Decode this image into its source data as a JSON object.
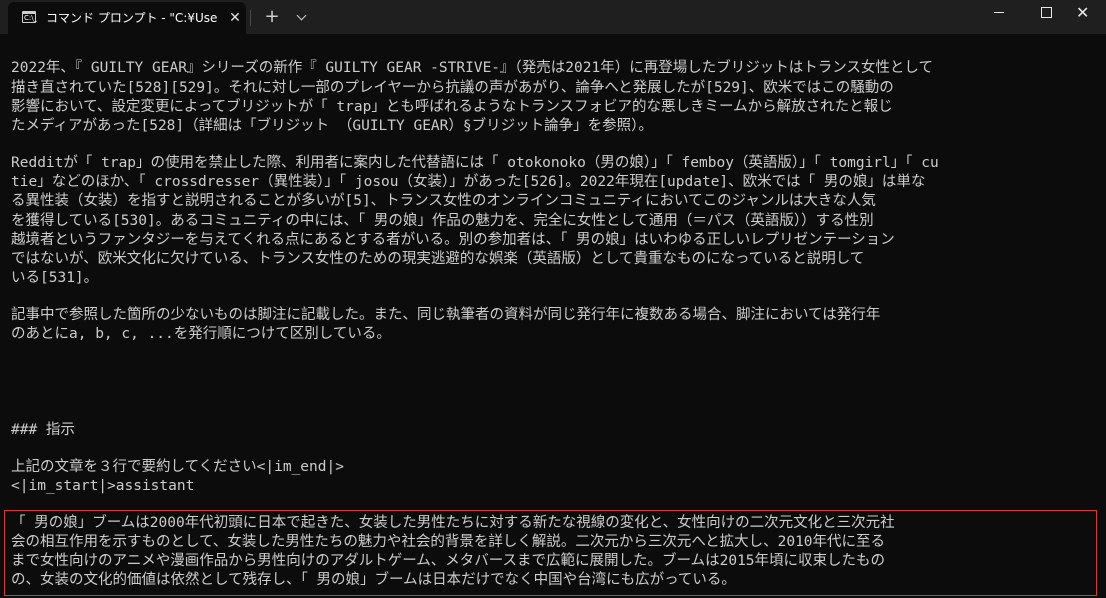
{
  "window": {
    "tab_icon_glyph": "C:\\_",
    "tab_title": "コマンド プロンプト - \"C:¥Users¥de",
    "close_tab": "✕",
    "new_tab": "+",
    "minimize_icon": "minimize-icon",
    "maximize_icon": "maximize-icon",
    "close_icon": "✕"
  },
  "console": {
    "para1": [
      "2022年、『 GUILTY GEAR』シリーズの新作『 GUILTY GEAR -STRIVE-』（発売は2021年）に再登場したブリジットはトランス女性として",
      "描き直されていた[528][529]。それに対し一部のプレイヤーから抗議の声があがり、論争へと発展したが[529]、欧米ではこの騒動の",
      "影響において、設定変更によってブリジットが「 trap」とも呼ばれるようなトランスフォビア的な悪しきミームから解放されたと報じ",
      "たメディアがあった[528]（詳細は「ブリジット （GUILTY GEAR）§ブリジット論争」を参照）。"
    ],
    "para2": [
      "Redditが「 trap」の使用を禁止した際、利用者に案内した代替語には「 otokonoko（男の娘）」「 femboy（英語版）」「 tomgirl」「 cu",
      "tie」などのほか、「 crossdresser（異性装）」「 josou（女装）」があった[526]。2022年現在[update]、欧米では「 男の娘」は単な",
      "る異性装（女装）を指すと説明されることが多いが[5]、トランス女性のオンラインコミュニティにおいてこのジャンルは大きな人気",
      "を獲得している[530]。あるコミュニティの中には、「 男の娘」作品の魅力を、完全に女性として通用（＝パス（英語版））する性別",
      "越境者というファンタジーを与えてくれる点にあるとする者がいる。別の参加者は、「 男の娘」はいわゆる正しいレプリゼンテーション",
      "ではないが、欧米文化に欠けている、トランス女性のための現実逃避的な娯楽（英語版）として貴重なものになっていると説明して",
      "いる[531]。"
    ],
    "para3": [
      "記事中で参照した箇所の少ないものは脚注に記載した。また、同じ執筆者の資料が同じ発行年に複数ある場合、脚注においては発行年",
      "のあとにa, b, c, ...を発行順につけて区別している。"
    ],
    "heading": "### 指示",
    "instruction": "上記の文章を３行で要約してください<|im_end|>",
    "assistant_tag": "<|im_start|>assistant",
    "response": [
      "「 男の娘」ブームは2000年代初頭に日本で起きた、女装した男性たちに対する新たな視線の変化と、女性向けの二次元文化と三次元社",
      "会の相互作用を示すものとして、女装した男性たちの魅力や社会的背景を詳しく解説。二次元から三次元へと拡大し、2010年代に至る",
      "まで女性向けのアニメや漫画作品から男性向けのアダルトゲーム、メタバースまで広範に展開した。ブームは2015年頃に収束したもの",
      "の、女装の文化的価値は依然として残存し、「 男の娘」ブームは日本だけでなく中国や台湾にも広がっている。"
    ],
    "highlight_color": "#d43a3a"
  }
}
